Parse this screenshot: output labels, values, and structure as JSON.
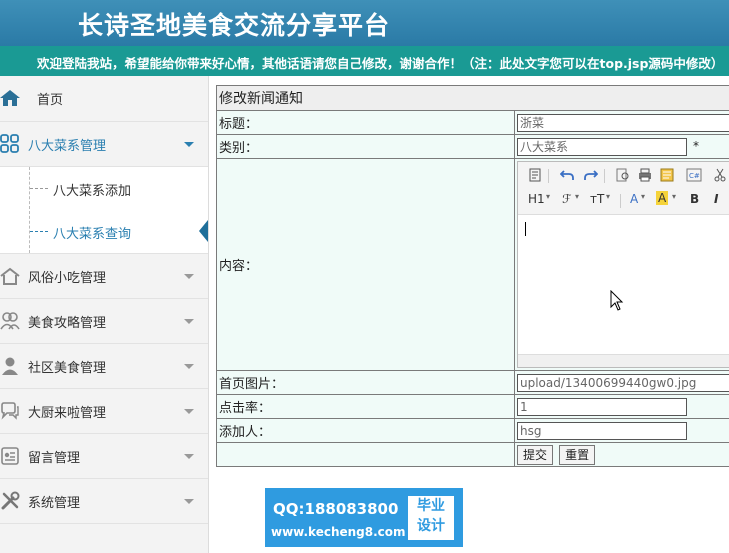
{
  "header": {
    "title": "长诗圣地美食交流分享平台",
    "notice": "欢迎登陆我站，希望能给你带来好心情，其他话语请您自己修改，谢谢合作！（注：此处文字您可以在top.jsp源码中修改）"
  },
  "sidebar": {
    "home": "首页",
    "groups": [
      {
        "label": "八大菜系管理",
        "expanded": true,
        "children": [
          "八大菜系添加",
          "八大菜系查询"
        ],
        "active_child": 1
      },
      {
        "label": "风俗小吃管理"
      },
      {
        "label": "美食攻略管理"
      },
      {
        "label": "社区美食管理"
      },
      {
        "label": "大厨来啦管理"
      },
      {
        "label": "留言管理"
      },
      {
        "label": "系统管理"
      }
    ]
  },
  "form": {
    "heading": "修改新闻通知",
    "title_label": "标题：",
    "title_value": "浙菜",
    "category_label": "类别：",
    "category_value": "八大菜系",
    "required_mark": "*",
    "content_label": "内容：",
    "image_label": "首页图片：",
    "image_value": "upload/13400699440gw0.jpg",
    "clicks_label": "点击率：",
    "clicks_value": "1",
    "author_label": "添加人：",
    "author_value": "hsg",
    "submit_label": "提交",
    "reset_label": "重置"
  },
  "editor_toolbar": {
    "row1": [
      "source-icon",
      "undo-icon",
      "redo-icon",
      "preview-icon",
      "print-icon",
      "template-icon",
      "code-icon",
      "cut-icon"
    ],
    "row2": [
      "H1",
      "ℱ",
      "тT",
      "A",
      "A",
      "B",
      "I"
    ]
  },
  "watermark": {
    "qq": "QQ:188083800",
    "url": "www.kecheng8.com",
    "badge_line1": "毕业",
    "badge_line2": "设计"
  },
  "colors": {
    "header_bg": "#2a7aa6",
    "notice_bg": "#1a9a94",
    "accent": "#2a7fb0",
    "form_bg": "#f0fbf8"
  }
}
